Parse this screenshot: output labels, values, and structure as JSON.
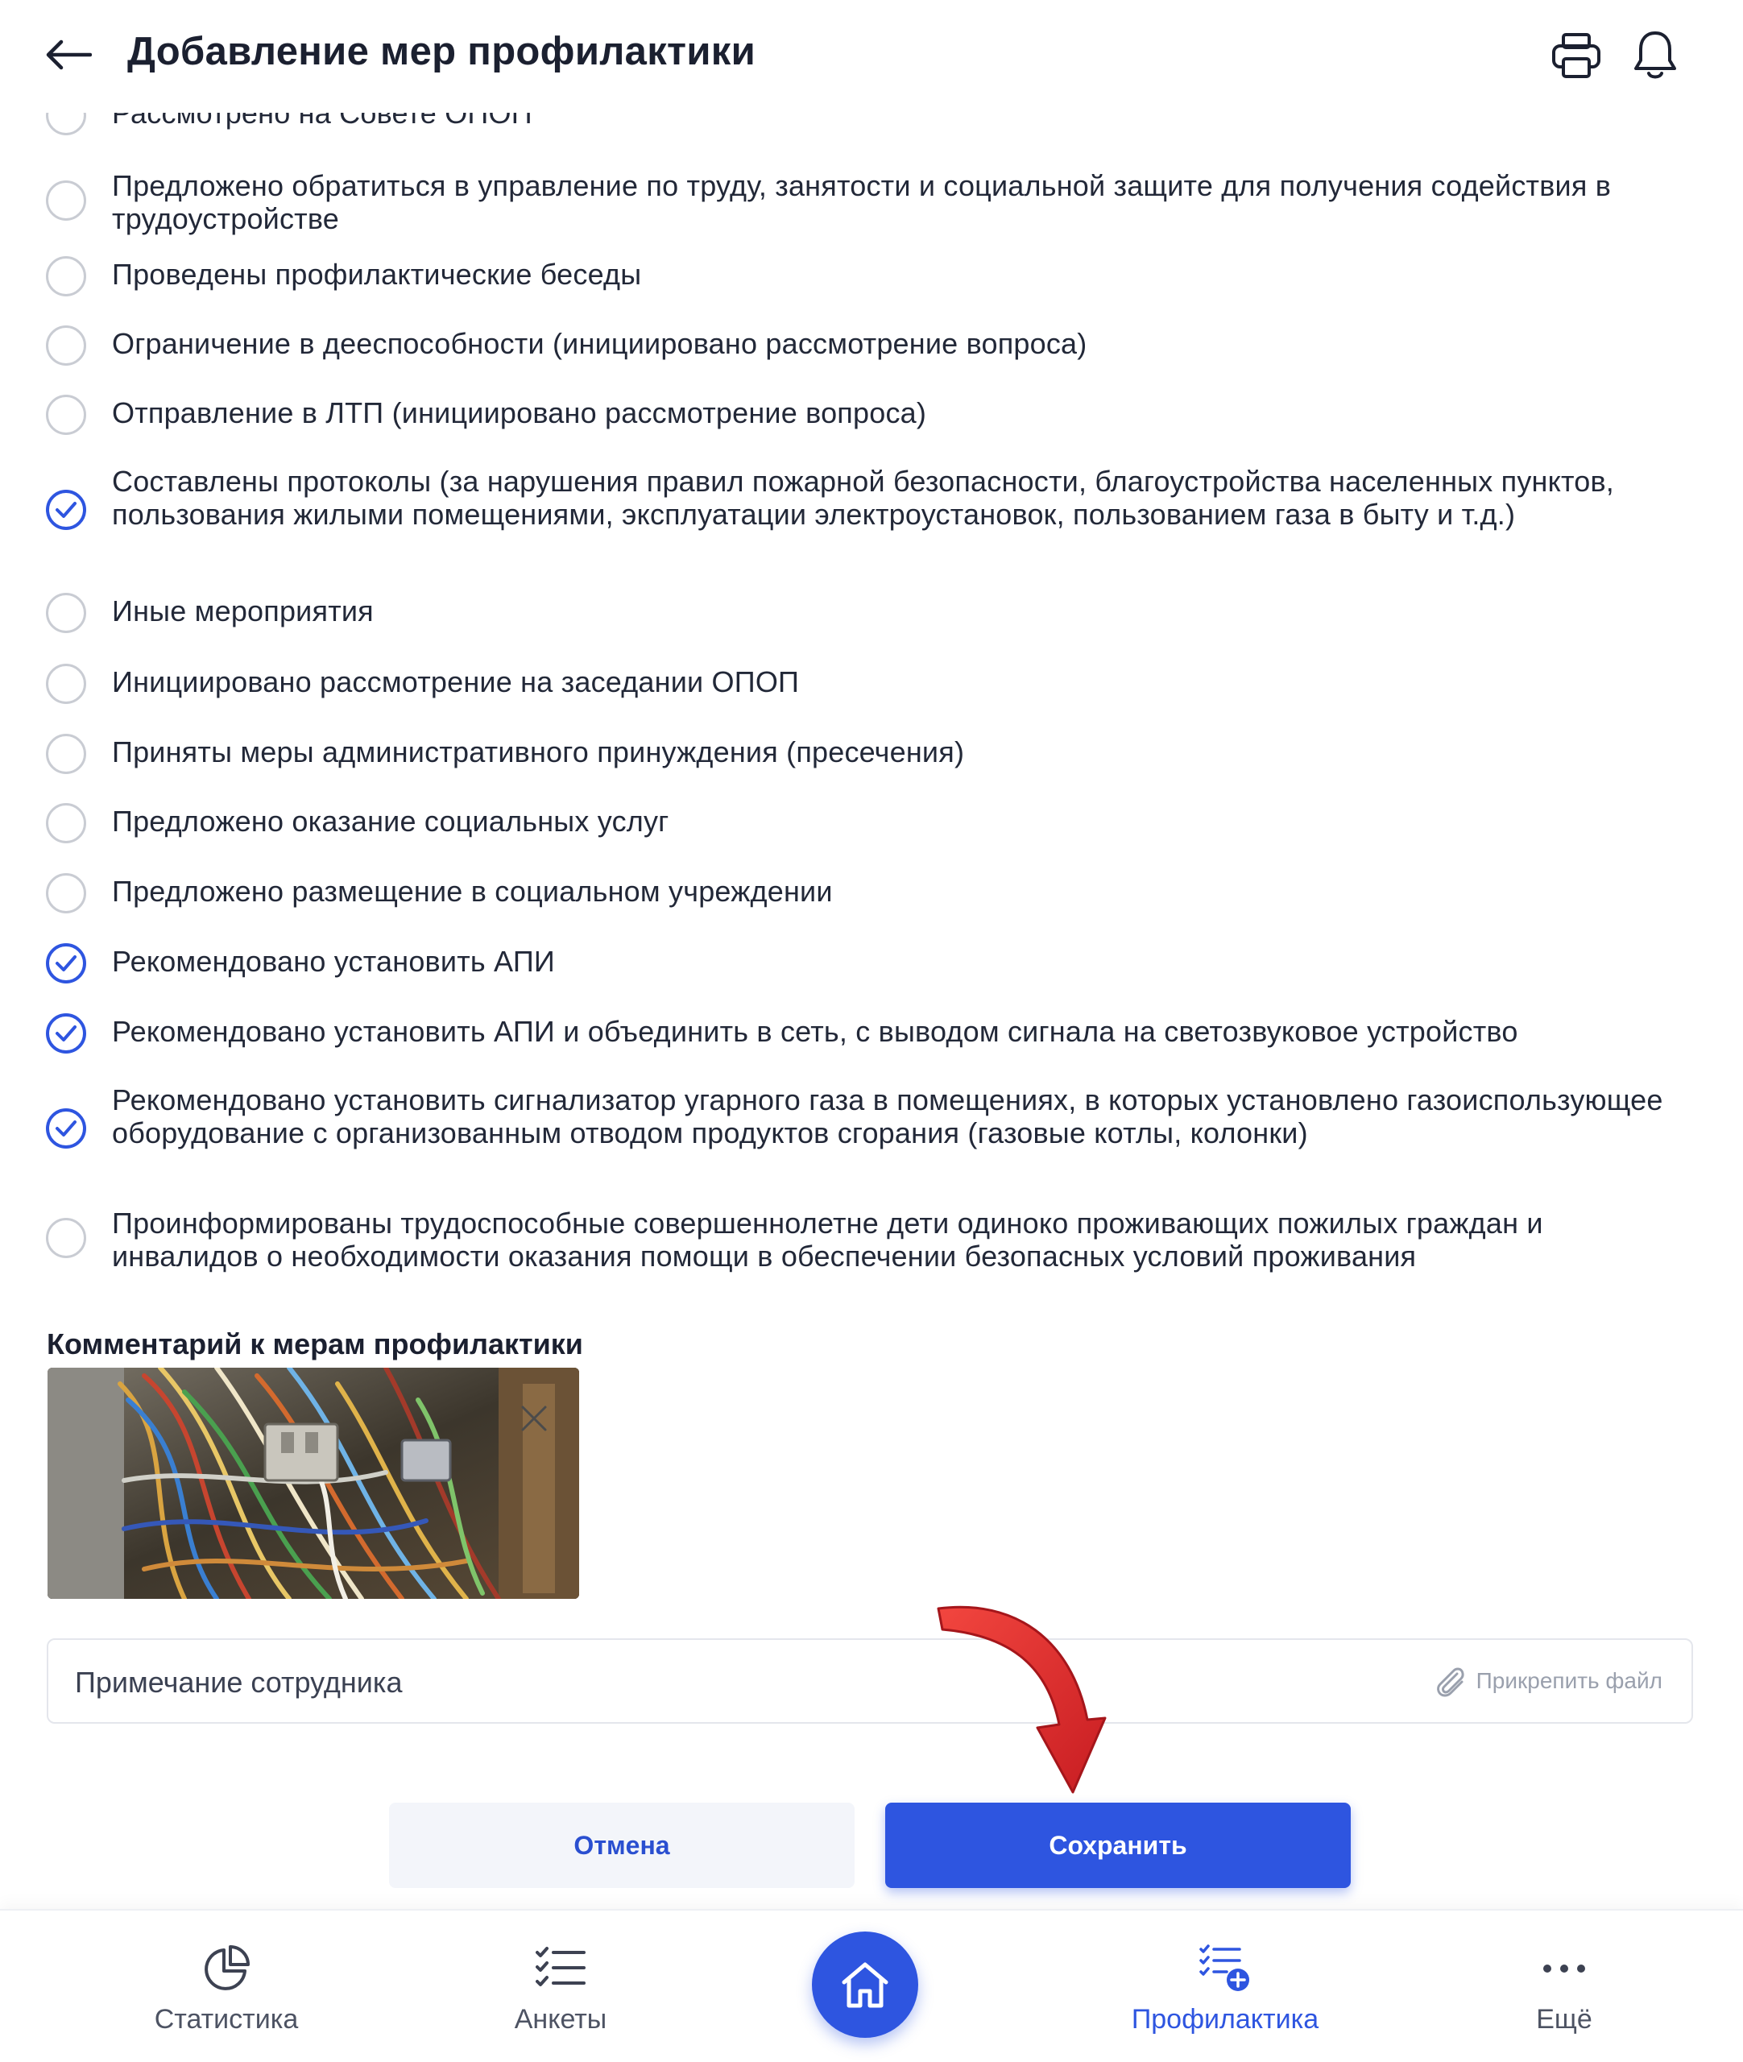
{
  "header": {
    "title": "Добавление мер профилактики",
    "back_icon": "arrow-left-icon",
    "print_icon": "printer-icon",
    "notification_icon": "bell-icon"
  },
  "measures": [
    {
      "label": "Рассмотрено на Совете ОПОП",
      "checked": false
    },
    {
      "label": "Предложено обратиться в управление по труду, занятости и социальной защите для получения содействия в трудоустройстве",
      "checked": false
    },
    {
      "label": "Проведены профилактические беседы",
      "checked": false
    },
    {
      "label": "Ограничение в дееспособности (инициировано рассмотрение вопроса)",
      "checked": false
    },
    {
      "label": "Отправление в ЛТП (инициировано рассмотрение вопроса)",
      "checked": false
    },
    {
      "label": "Составлены протоколы (за нарушения правил пожарной безопасности, благоустройства населенных пунктов, пользования жилыми помещениями, эксплуатации электроустановок, пользованием газа в быту и т.д.)",
      "checked": true
    },
    {
      "label": "Иные мероприятия",
      "checked": false
    },
    {
      "label": "Инициировано рассмотрение на заседании ОПОП",
      "checked": false
    },
    {
      "label": "Приняты меры административного принуждения (пресечения)",
      "checked": false
    },
    {
      "label": "Предложено оказание социальных услуг",
      "checked": false
    },
    {
      "label": "Предложено размещение в социальном учреждении",
      "checked": false
    },
    {
      "label": "Рекомендовано установить АПИ",
      "checked": true
    },
    {
      "label": "Рекомендовано установить АПИ и объединить в сеть, с выводом сигнала на светозвуковое устройство",
      "checked": true
    },
    {
      "label": "Рекомендовано установить сигнализатор угарного газа в помещениях, в которых установлено газоиспользующее оборудование с организованным отводом продуктов сгорания (газовые котлы, колонки)",
      "checked": true
    },
    {
      "label": "Проинформированы трудоспособные совершеннолетне дети одиноко проживающих пожилых граждан и инвалидов о необходимости оказания помощи в обеспечении безопасных условий проживания",
      "checked": false
    }
  ],
  "comment": {
    "label": "Комментарий к мерам профилактики",
    "photo_alt": "Фото спутанных электрических проводов в щитке",
    "remove_icon": "close-icon"
  },
  "note": {
    "placeholder": "Примечание сотрудника",
    "attach_label": "Прикрепить файл",
    "attach_icon": "paperclip-icon"
  },
  "actions": {
    "cancel_label": "Отмена",
    "save_label": "Сохранить"
  },
  "bottom_nav": {
    "items": [
      {
        "label": "Статистика",
        "icon": "pie-chart-icon",
        "active": false
      },
      {
        "label": "Анкеты",
        "icon": "checklist-icon",
        "active": false
      },
      {
        "label": "Профилактика",
        "icon": "checklist-add-icon",
        "active": true
      },
      {
        "label": "Ещё",
        "icon": "more-dots-icon",
        "active": false
      }
    ],
    "home_icon": "home-icon"
  },
  "colors": {
    "accent": "#2e55e0",
    "text": "#222838",
    "radio_border": "#c9ccd3",
    "annotation_arrow": "#e3262b"
  }
}
